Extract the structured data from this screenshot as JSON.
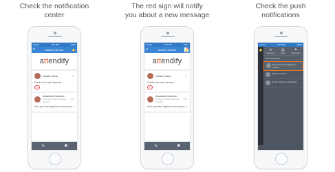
{
  "panels": [
    {
      "caption_lines": [
        "Check the notification",
        "center"
      ],
      "bell_active": false
    },
    {
      "caption_lines": [
        "The red sign will notify",
        "you about a new message"
      ],
      "bell_active": true
    },
    {
      "caption_lines": [
        "Check the push",
        "notifications"
      ]
    }
  ],
  "app": {
    "status_left": "Carrier",
    "status_time": "3:07 PM",
    "status_right": "100%",
    "title": "Activity Stream",
    "logo_pre": "a",
    "logo_t": "tt",
    "logo_post": "endify",
    "posts": [
      {
        "author": "Natalie Shirlar",
        "subtitle": "",
        "time": "1h",
        "text": "Great to be here! #events"
      },
      {
        "author": "Anastasia Vlasenko",
        "subtitle": "Customer Support Manager, Attendify",
        "time": "15m",
        "text": "Give your best caption to win a prize :)"
      }
    ],
    "bottom_icons": [
      "pencil-icon",
      "camera-icon"
    ]
  },
  "dark": {
    "tabs": [
      {
        "label": "Messages",
        "icon": "envelope-icon"
      },
      {
        "label": "Notes",
        "icon": "note-icon"
      },
      {
        "label": "Bookmarks",
        "icon": "bookmark-icon"
      }
    ],
    "section": "NOTIFICATIONS",
    "notifications": [
      {
        "text": "Don't miss the workshop at 3:00pm!",
        "highlight": true
      },
      {
        "text": "Please, welcome...",
        "highlight": false
      },
      {
        "text": "Hi Alex, thanks for signing up!",
        "highlight": false
      }
    ]
  },
  "colors": {
    "brand_blue": "#3a86d4",
    "accent_orange": "#e5782f",
    "alert_red": "#e23a3a"
  }
}
